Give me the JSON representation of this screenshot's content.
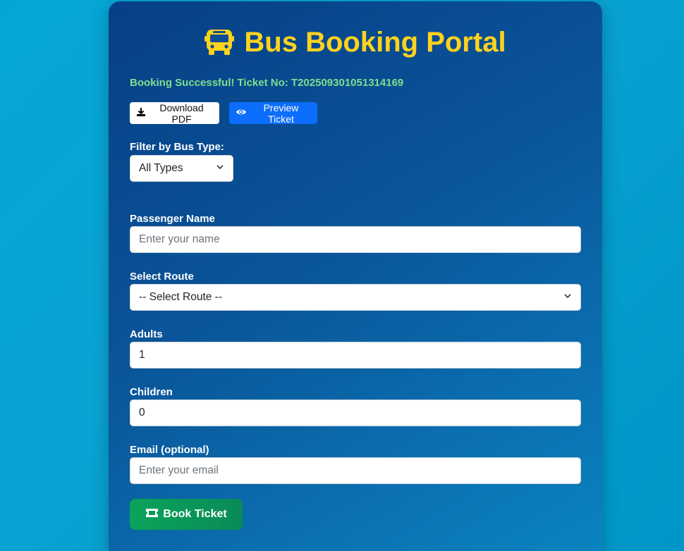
{
  "header": {
    "title": "Bus Booking Portal",
    "icon": "bus-icon",
    "title_color": "#ffd21f"
  },
  "status": {
    "message": "Booking Successful! Ticket No: T20250930105131416​9"
  },
  "actions": {
    "download_label": "Download PDF",
    "preview_label": "Preview Ticket"
  },
  "filter": {
    "label": "Filter by Bus Type:",
    "selected": "All Types"
  },
  "form": {
    "name_label": "Passenger Name",
    "name_placeholder": "Enter your name",
    "route_label": "Select Route",
    "route_selected": "-- Select Route --",
    "adults_label": "Adults",
    "adults_value": "1",
    "children_label": "Children",
    "children_value": "0",
    "email_label": "Email (optional)",
    "email_placeholder": "Enter your email",
    "submit_label": "Book Ticket"
  },
  "colors": {
    "success": "#7be08e",
    "primary": "#0d6efd",
    "book": "#0aa45a"
  }
}
